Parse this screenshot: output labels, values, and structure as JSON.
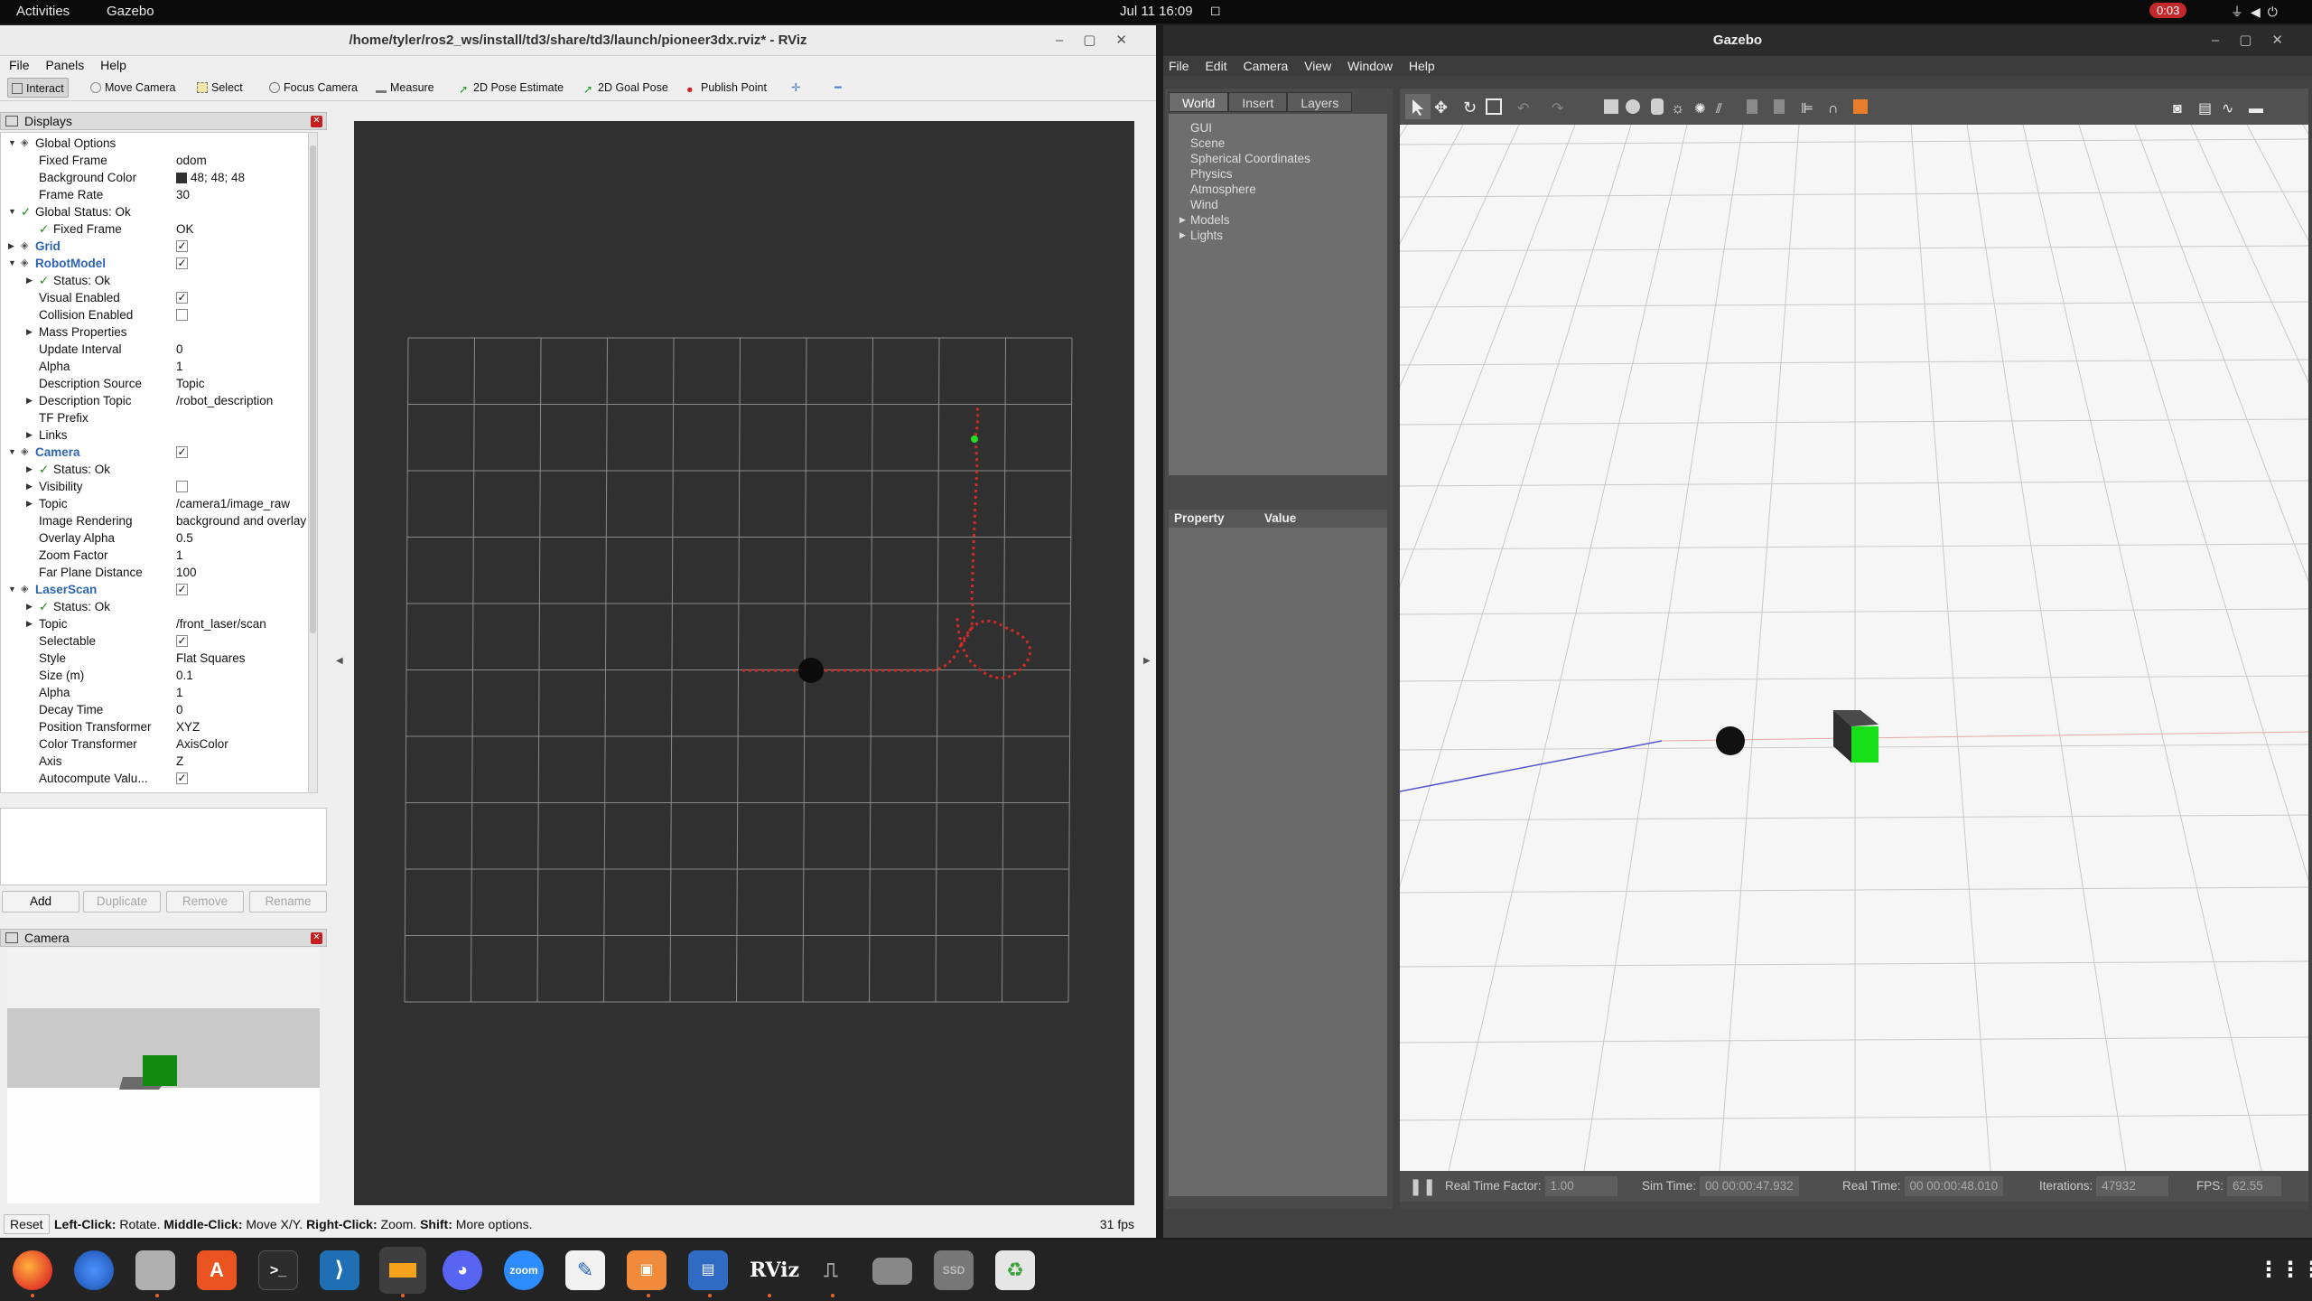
{
  "topbar": {
    "activities": "Activities",
    "app": "Gazebo",
    "clock": "Jul 11  16:09",
    "recording": "0:03"
  },
  "rviz": {
    "title": "/home/tyler/ros2_ws/install/td3/share/td3/launch/pioneer3dx.rviz* - RViz",
    "menu": [
      "File",
      "Panels",
      "Help"
    ],
    "tools": [
      "Interact",
      "Move Camera",
      "Select",
      "Focus Camera",
      "Measure",
      "2D Pose Estimate",
      "2D Goal Pose",
      "Publish Point"
    ],
    "displays_title": "Displays",
    "tree": [
      {
        "label": "Global Options",
        "indent": 0,
        "arrow": "down",
        "icon": "gear-icon"
      },
      {
        "label": "Fixed Frame",
        "value": "odom",
        "indent": 1
      },
      {
        "label": "Background Color",
        "value": "48; 48; 48",
        "indent": 1,
        "swatch": "#303030"
      },
      {
        "label": "Frame Rate",
        "value": "30",
        "indent": 1
      },
      {
        "label": "Global Status: Ok",
        "indent": 0,
        "arrow": "down",
        "ok": true
      },
      {
        "label": "Fixed Frame",
        "value": "OK",
        "indent": 1,
        "ok": true
      },
      {
        "label": "Grid",
        "indent": 0,
        "arrow": "right",
        "blue": true,
        "check": true
      },
      {
        "label": "RobotModel",
        "indent": 0,
        "arrow": "down",
        "blue": true,
        "check": true
      },
      {
        "label": "Status: Ok",
        "indent": 1,
        "arrow": "right",
        "ok": true
      },
      {
        "label": "Visual Enabled",
        "indent": 1,
        "check": true
      },
      {
        "label": "Collision Enabled",
        "indent": 1,
        "check": false
      },
      {
        "label": "Mass Properties",
        "indent": 1,
        "arrow": "right"
      },
      {
        "label": "Update Interval",
        "value": "0",
        "indent": 1
      },
      {
        "label": "Alpha",
        "value": "1",
        "indent": 1
      },
      {
        "label": "Description Source",
        "value": "Topic",
        "indent": 1
      },
      {
        "label": "Description Topic",
        "value": "/robot_description",
        "indent": 1,
        "arrow": "right"
      },
      {
        "label": "TF Prefix",
        "value": "",
        "indent": 1
      },
      {
        "label": "Links",
        "indent": 1,
        "arrow": "right"
      },
      {
        "label": "Camera",
        "indent": 0,
        "arrow": "down",
        "blue": true,
        "check": true
      },
      {
        "label": "Status: Ok",
        "indent": 1,
        "arrow": "right",
        "ok": true
      },
      {
        "label": "Visibility",
        "indent": 1,
        "arrow": "right",
        "check": false
      },
      {
        "label": "Topic",
        "value": "/camera1/image_raw",
        "indent": 1,
        "arrow": "right"
      },
      {
        "label": "Image Rendering",
        "value": "background and overlay",
        "indent": 1
      },
      {
        "label": "Overlay Alpha",
        "value": "0.5",
        "indent": 1
      },
      {
        "label": "Zoom Factor",
        "value": "1",
        "indent": 1
      },
      {
        "label": "Far Plane Distance",
        "value": "100",
        "indent": 1
      },
      {
        "label": "LaserScan",
        "indent": 0,
        "arrow": "down",
        "blue": true,
        "check": true
      },
      {
        "label": "Status: Ok",
        "indent": 1,
        "arrow": "right",
        "ok": true
      },
      {
        "label": "Topic",
        "value": "/front_laser/scan",
        "indent": 1,
        "arrow": "right"
      },
      {
        "label": "Selectable",
        "indent": 1,
        "check": true
      },
      {
        "label": "Style",
        "value": "Flat Squares",
        "indent": 1
      },
      {
        "label": "Size (m)",
        "value": "0.1",
        "indent": 1
      },
      {
        "label": "Alpha",
        "value": "1",
        "indent": 1
      },
      {
        "label": "Decay Time",
        "value": "0",
        "indent": 1
      },
      {
        "label": "Position Transformer",
        "value": "XYZ",
        "indent": 1
      },
      {
        "label": "Color Transformer",
        "value": "AxisColor",
        "indent": 1
      },
      {
        "label": "Axis",
        "value": "Z",
        "indent": 1
      },
      {
        "label": "Autocompute Valu...",
        "indent": 1,
        "check": true
      }
    ],
    "buttons": {
      "add": "Add",
      "duplicate": "Duplicate",
      "remove": "Remove",
      "rename": "Rename"
    },
    "camera_title": "Camera",
    "status": {
      "reset": "Reset",
      "hint_left": "Left-Click:",
      "hint_left_v": " Rotate. ",
      "hint_mid": "Middle-Click:",
      "hint_mid_v": " Move X/Y. ",
      "hint_right": "Right-Click:",
      "hint_right_v": " Zoom. ",
      "hint_shift": "Shift:",
      "hint_shift_v": " More options.",
      "fps": "31 fps"
    }
  },
  "gazebo": {
    "title": "Gazebo",
    "menu": [
      "File",
      "Edit",
      "Camera",
      "View",
      "Window",
      "Help"
    ],
    "tabs": [
      "World",
      "Insert",
      "Layers"
    ],
    "world_items": [
      {
        "label": "GUI",
        "expandable": false
      },
      {
        "label": "Scene",
        "expandable": false
      },
      {
        "label": "Spherical Coordinates",
        "expandable": false
      },
      {
        "label": "Physics",
        "expandable": false
      },
      {
        "label": "Atmosphere",
        "expandable": false
      },
      {
        "label": "Wind",
        "expandable": false
      },
      {
        "label": "Models",
        "expandable": true
      },
      {
        "label": "Lights",
        "expandable": true
      }
    ],
    "property_header": "Property",
    "value_header": "Value",
    "bottom": {
      "rtf_label": "Real Time Factor:",
      "rtf": "1.00",
      "sim_label": "Sim Time:",
      "sim": "00 00:00:47.932",
      "real_label": "Real Time:",
      "real": "00 00:00:48.010",
      "iter_label": "Iterations:",
      "iter": "47932",
      "fps_label": "FPS:",
      "fps": "62.55"
    }
  },
  "dock": {
    "apps": [
      "firefox",
      "thunderbird",
      "files",
      "app-center",
      "terminal",
      "vscode",
      "sublime",
      "discord",
      "zoom",
      "text-editor",
      "impress",
      "writer",
      "rviz",
      "usb",
      "drive",
      "ssd",
      "trash"
    ],
    "zoom_label": "zoom",
    "rviz_label": "RViz",
    "ssd_label": "SSD"
  }
}
